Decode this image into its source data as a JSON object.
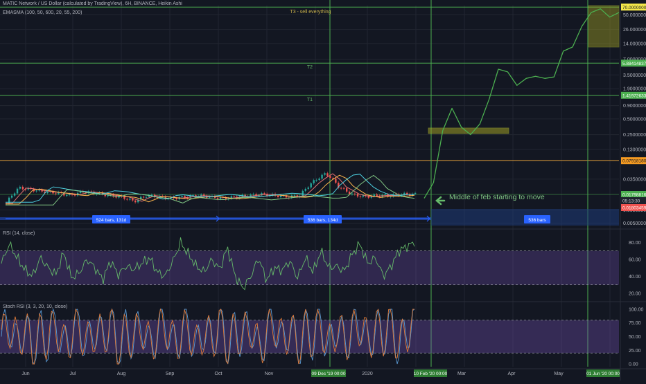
{
  "header": {
    "symbol_line": "MATIC Network / US Dollar (calculated by TradingView), 6H, BINANCE, Heikin Ashi",
    "indicator_line": "EMASMA (100, 50, 600, 20, 55, 200)"
  },
  "panes": {
    "rsi_title": "RSI (14, close)",
    "stoch_title": "Stoch RSI (3, 3, 20, 10, close)"
  },
  "annotations": {
    "t3": "T3 - sell everything",
    "t2": "T2",
    "t1": "T1",
    "move_note": "Middle of feb starting to move",
    "range1": "524 bars, 131d",
    "range2": "536 bars, 134d",
    "range3": "536 bars"
  },
  "colors": {
    "background": "#131722",
    "grid": "#222631",
    "target_line": "#4caf50",
    "price_line": "#e8a33b",
    "projection": "#4caf50",
    "range_bar": "#2962ff",
    "rsi_band": "#7e57c2",
    "rsi_line": "#66bb6a",
    "stoch_k": "#5b9bd5",
    "stoch_d": "#e07b39"
  },
  "chart_data": [
    {
      "type": "candlestick",
      "title": "MATIC Network / US Dollar",
      "scale": "log",
      "ylim": [
        0.0045,
        75
      ],
      "y_ticks": [
        "50.0000000",
        "26.0000000",
        "14.0000000",
        "7.0000000",
        "3.5000000",
        "1.9000000",
        "0.9000000",
        "0.5000000",
        "0.2500000",
        "0.1300000",
        "0.0350000",
        "0.0090000",
        "0.0050000"
      ],
      "y_tick_values": [
        50,
        26,
        14,
        7,
        3.5,
        1.9,
        0.9,
        0.5,
        0.25,
        0.13,
        0.035,
        0.009,
        0.005
      ],
      "price_labels": [
        {
          "text": "70.00000000",
          "value": 70,
          "style": "yellow"
        },
        {
          "text": "5.88414837",
          "value": 5.88,
          "style": "green"
        },
        {
          "text": "1.41972633",
          "value": 1.42,
          "style": "green"
        },
        {
          "text": "0.07918180",
          "value": 0.0792,
          "style": "orange"
        },
        {
          "text": "0.01798816",
          "value": 0.018,
          "style": "green"
        },
        {
          "text": "05:13:30",
          "value": 0.0147,
          "style": "dark"
        },
        {
          "text": "0.01803459",
          "value": 0.0118,
          "style": "red"
        }
      ],
      "x_ticks": [
        "Jun",
        "Jul",
        "Aug",
        "Sep",
        "Oct",
        "Nov",
        "2020",
        "Mar",
        "Apr",
        "May"
      ],
      "x_highlights": [
        "09 Dec '19",
        "00:00",
        "10 Feb '20",
        "00:00",
        "01 Jun '20",
        "00:00"
      ],
      "target_levels": [
        70,
        5.88,
        1.42,
        0.0792
      ],
      "series": [
        {
          "name": "Heikin Ashi",
          "values": [
            0.012,
            0.024,
            0.022,
            0.02,
            0.019,
            0.017,
            0.02,
            0.019,
            0.017,
            0.016,
            0.013,
            0.017,
            0.016,
            0.015,
            0.016,
            0.017,
            0.016,
            0.015,
            0.016,
            0.017,
            0.018,
            0.017,
            0.016,
            0.017,
            0.031,
            0.045,
            0.025,
            0.018,
            0.016,
            0.017,
            0.017,
            0.018,
            0.018
          ]
        },
        {
          "name": "Projection",
          "values": [
            0.015,
            0.03,
            0.3,
            0.8,
            0.35,
            0.25,
            0.4,
            1.2,
            4.5,
            4,
            2.2,
            3.0,
            3.3,
            3.0,
            3.2,
            10,
            12,
            30,
            55,
            65,
            45,
            55
          ]
        }
      ]
    },
    {
      "type": "line",
      "title": "RSI (14, close)",
      "ylim": [
        15,
        90
      ],
      "y_ticks": [
        "80.00",
        "60.00",
        "40.00",
        "20.00"
      ],
      "y_tick_values": [
        80,
        60,
        40,
        20
      ],
      "bands": [
        30,
        70
      ],
      "series": [
        {
          "name": "RSI",
          "values": [
            55,
            78,
            62,
            48,
            40,
            62,
            50,
            42,
            68,
            38,
            44,
            60,
            50,
            36,
            58,
            42,
            52,
            48,
            55,
            62,
            45,
            40,
            58,
            80,
            66,
            52,
            45,
            60,
            48,
            74,
            40,
            26,
            40,
            62,
            35,
            50,
            47,
            58,
            38,
            62,
            45,
            70,
            50,
            52,
            46,
            66,
            78,
            55,
            62,
            40,
            52,
            70,
            75,
            80
          ]
        }
      ]
    },
    {
      "type": "line",
      "title": "Stoch RSI (3, 3, 20, 10, close)",
      "ylim": [
        -5,
        105
      ],
      "y_ticks": [
        "100.00",
        "75.00",
        "50.00",
        "25.00",
        "0.00"
      ],
      "y_tick_values": [
        100,
        75,
        50,
        25,
        0
      ],
      "bands": [
        20,
        80
      ],
      "series": [
        {
          "name": "%K",
          "values": [
            50,
            95,
            20,
            85,
            5,
            70,
            30,
            100,
            10,
            60,
            90,
            15,
            80,
            40,
            100,
            0,
            75,
            35,
            95,
            10,
            65,
            100,
            20,
            55,
            90,
            5,
            80,
            30,
            100,
            15,
            70,
            45,
            95,
            0,
            60,
            100,
            25,
            85,
            10,
            75,
            40,
            100,
            5,
            90,
            30,
            65,
            100,
            20,
            80,
            50,
            100,
            10,
            70,
            100
          ]
        },
        {
          "name": "%D",
          "values": [
            45,
            85,
            35,
            75,
            15,
            60,
            40,
            90,
            20,
            55,
            80,
            25,
            70,
            45,
            90,
            10,
            65,
            40,
            85,
            20,
            60,
            90,
            30,
            50,
            80,
            15,
            70,
            35,
            90,
            25,
            65,
            50,
            85,
            10,
            55,
            90,
            35,
            75,
            20,
            70,
            45,
            90,
            15,
            80,
            35,
            60,
            90,
            30,
            75,
            55,
            90,
            20,
            65,
            95
          ]
        }
      ]
    }
  ]
}
